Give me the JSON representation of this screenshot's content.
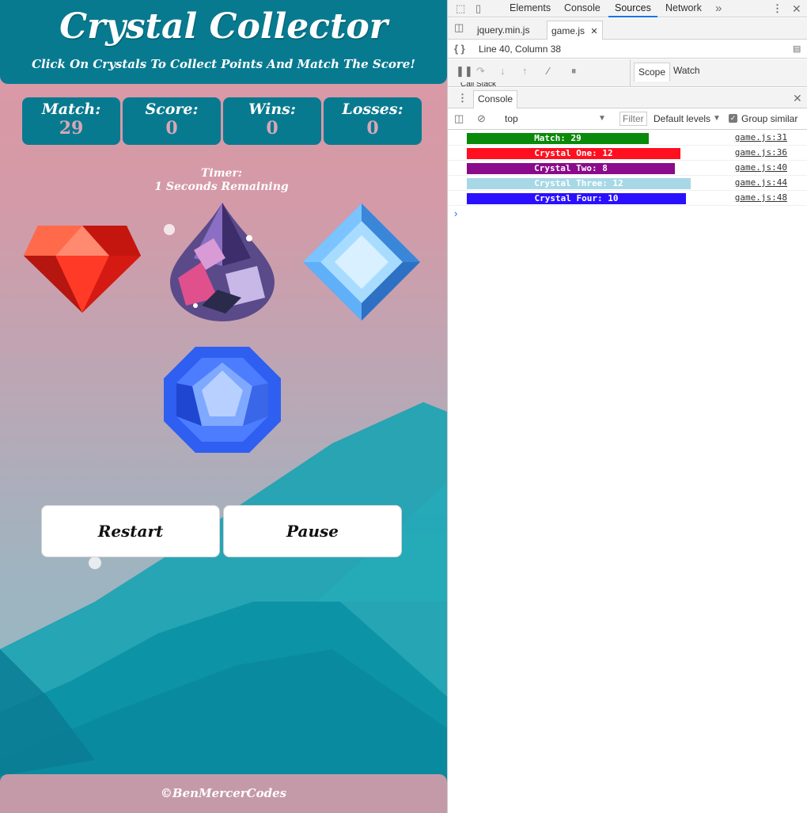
{
  "game": {
    "title": "Crystal Collector",
    "subtitle": "Click On Crystals To Collect Points And Match The Score!",
    "stats": [
      {
        "label": "Match:",
        "value": "29"
      },
      {
        "label": "Score:",
        "value": "0"
      },
      {
        "label": "Wins:",
        "value": "0"
      },
      {
        "label": "Losses:",
        "value": "0"
      }
    ],
    "timer_label": "Timer:",
    "timer_text": "1 Seconds Remaining",
    "crystals": [
      "red-crystal",
      "purple-drop-crystal",
      "light-blue-square-crystal",
      "blue-round-crystal"
    ],
    "restart_label": "Restart",
    "pause_label": "Pause",
    "footer": "©BenMercerCodes"
  },
  "devtools": {
    "tabs": [
      "Elements",
      "Console",
      "Sources",
      "Network"
    ],
    "active_tab": "Sources",
    "more_icon": "»",
    "files": [
      "jquery.min.js",
      "game.js"
    ],
    "active_file": "game.js",
    "cursor_location": "Line 40, Column 38",
    "call_stack_label": "Call Stack",
    "scope_tab": "Scope",
    "watch_tab": "Watch",
    "console_tab": "Console",
    "context": "top",
    "filter_placeholder": "Filter",
    "levels": "Default levels",
    "group_similar": "Group similar",
    "logs": [
      {
        "text": "Match: 29",
        "color": "#0a8a0a",
        "source": "game.js:31"
      },
      {
        "text": "Crystal One: 12",
        "color": "#ff0f1f",
        "source": "game.js:36"
      },
      {
        "text": "Crystal Two: 8",
        "color": "#8b0a8b",
        "source": "game.js:40"
      },
      {
        "text": "Crystal Three: 12",
        "color": "#a8d8e6",
        "source": "game.js:44"
      },
      {
        "text": "Crystal Four: 10",
        "color": "#2a10ff",
        "source": "game.js:48"
      }
    ]
  }
}
